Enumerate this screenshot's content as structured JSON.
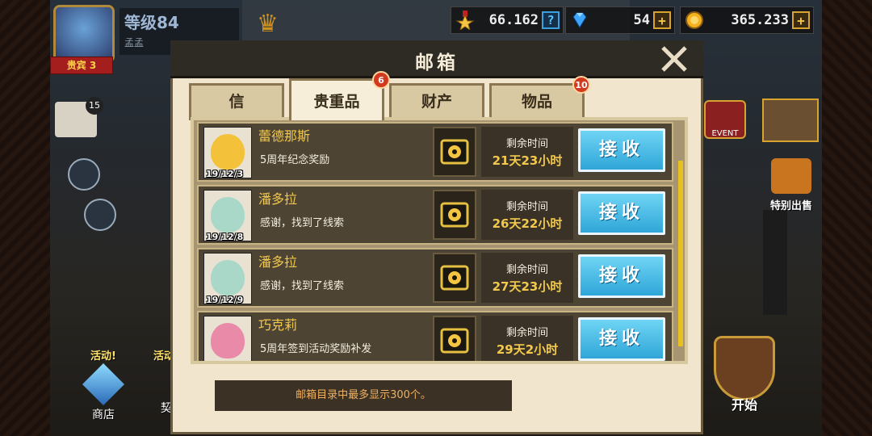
{
  "hud": {
    "level": "等级84",
    "player_name": "孟孟",
    "vip_label": "贵宾 3",
    "star_value": "66.162",
    "gem_value": "54",
    "gold_value": "365.233"
  },
  "side": {
    "mail_count": "15",
    "sale_label": "特别出售",
    "event_label": "EVENT",
    "store_event_label": "活动!",
    "store_label": "商店",
    "contract_event_label": "活动!",
    "contract_label": "契",
    "start_label": "开始"
  },
  "modal": {
    "title": "邮箱",
    "tabs": [
      {
        "label": "信",
        "badge": ""
      },
      {
        "label": "贵重品",
        "badge": "6"
      },
      {
        "label": "财产",
        "badge": ""
      },
      {
        "label": "物品",
        "badge": "10"
      }
    ],
    "mails": [
      {
        "sender": "蕾德那斯",
        "subject": "5周年纪念奖励",
        "date": "19/12/3",
        "time_label": "剩余时间",
        "time_left": "21天23小时",
        "button": "接收",
        "portrait_color": "#f3c23a"
      },
      {
        "sender": "潘多拉",
        "subject": "感谢，找到了线索",
        "date": "19/12/8",
        "time_label": "剩余时间",
        "time_left": "26天22小时",
        "button": "接收",
        "portrait_color": "#a9d8c8"
      },
      {
        "sender": "潘多拉",
        "subject": "感谢，找到了线索",
        "date": "19/12/9",
        "time_label": "剩余时间",
        "time_left": "27天23小时",
        "button": "接收",
        "portrait_color": "#a9d8c8"
      },
      {
        "sender": "巧克莉",
        "subject": "5周年签到活动奖励补发",
        "date": "",
        "time_label": "剩余时间",
        "time_left": "29天2小时",
        "button": "接收",
        "portrait_color": "#e88aa8"
      }
    ],
    "footer_note": "邮箱目录中最多显示300个。"
  },
  "colors": {
    "accent_blue": "#2fa6d8",
    "gold_text": "#f2c94c",
    "badge_red": "#d3391f"
  }
}
